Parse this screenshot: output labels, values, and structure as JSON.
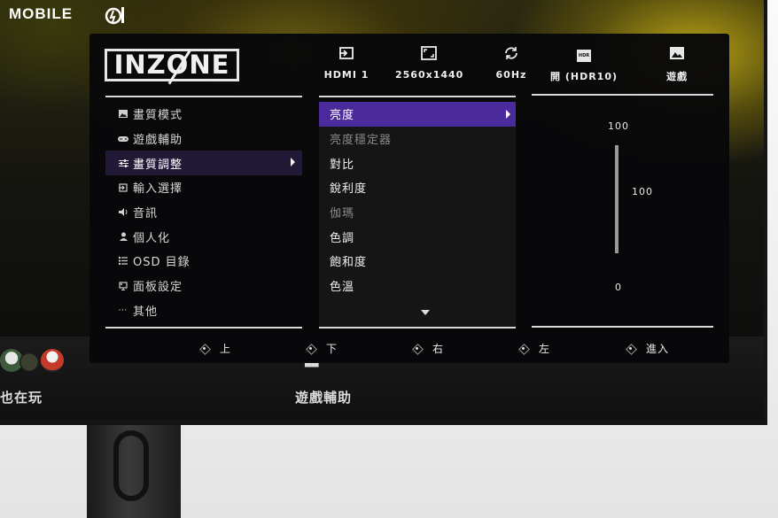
{
  "watermark": {
    "text": "MOBILE"
  },
  "osd": {
    "brand": "INZONE",
    "status_bar": [
      {
        "icon": "input-source-icon",
        "label": "HDMI 1"
      },
      {
        "icon": "resolution-icon",
        "label": "2560x1440"
      },
      {
        "icon": "refresh-rate-icon",
        "label": "60Hz"
      },
      {
        "icon": "hdr-icon",
        "icon_text": "HDR",
        "label": "開 (HDR10)"
      },
      {
        "icon": "picture-mode-icon",
        "label": "遊戲"
      }
    ],
    "main_menu": [
      {
        "icon": "picture-mode-icon",
        "label": "畫質模式"
      },
      {
        "icon": "gamepad-icon",
        "label": "遊戲輔助"
      },
      {
        "icon": "sliders-icon",
        "label": "畫質調整",
        "selected": true
      },
      {
        "icon": "input-icon",
        "label": "輸入選擇"
      },
      {
        "icon": "speaker-icon",
        "label": "音訊"
      },
      {
        "icon": "person-icon",
        "label": "個人化"
      },
      {
        "icon": "list-icon",
        "label": "OSD 目錄"
      },
      {
        "icon": "panel-icon",
        "label": "面板設定"
      },
      {
        "icon": "more-icon",
        "label": "其他"
      }
    ],
    "sub_menu": [
      {
        "label": "亮度",
        "selected": true
      },
      {
        "label": "亮度穩定器",
        "disabled": true
      },
      {
        "label": "對比"
      },
      {
        "label": "銳利度"
      },
      {
        "label": "伽瑪",
        "disabled": true
      },
      {
        "label": "色調"
      },
      {
        "label": "飽和度"
      },
      {
        "label": "色溫"
      }
    ],
    "slider": {
      "max_label": "100",
      "min_label": "0",
      "current_value": "100",
      "level": 1.0
    },
    "nav_hints": [
      {
        "label": "上"
      },
      {
        "label": "下"
      },
      {
        "label": "右"
      },
      {
        "label": "左"
      },
      {
        "label": "進入"
      }
    ]
  },
  "background_game": {
    "left_label": "也在玩",
    "center_label": "遊戲輔助"
  },
  "colors": {
    "main_menu_selected": "#221937",
    "sub_menu_selected": "#4b2a9b",
    "osd_background": "#08080a"
  }
}
